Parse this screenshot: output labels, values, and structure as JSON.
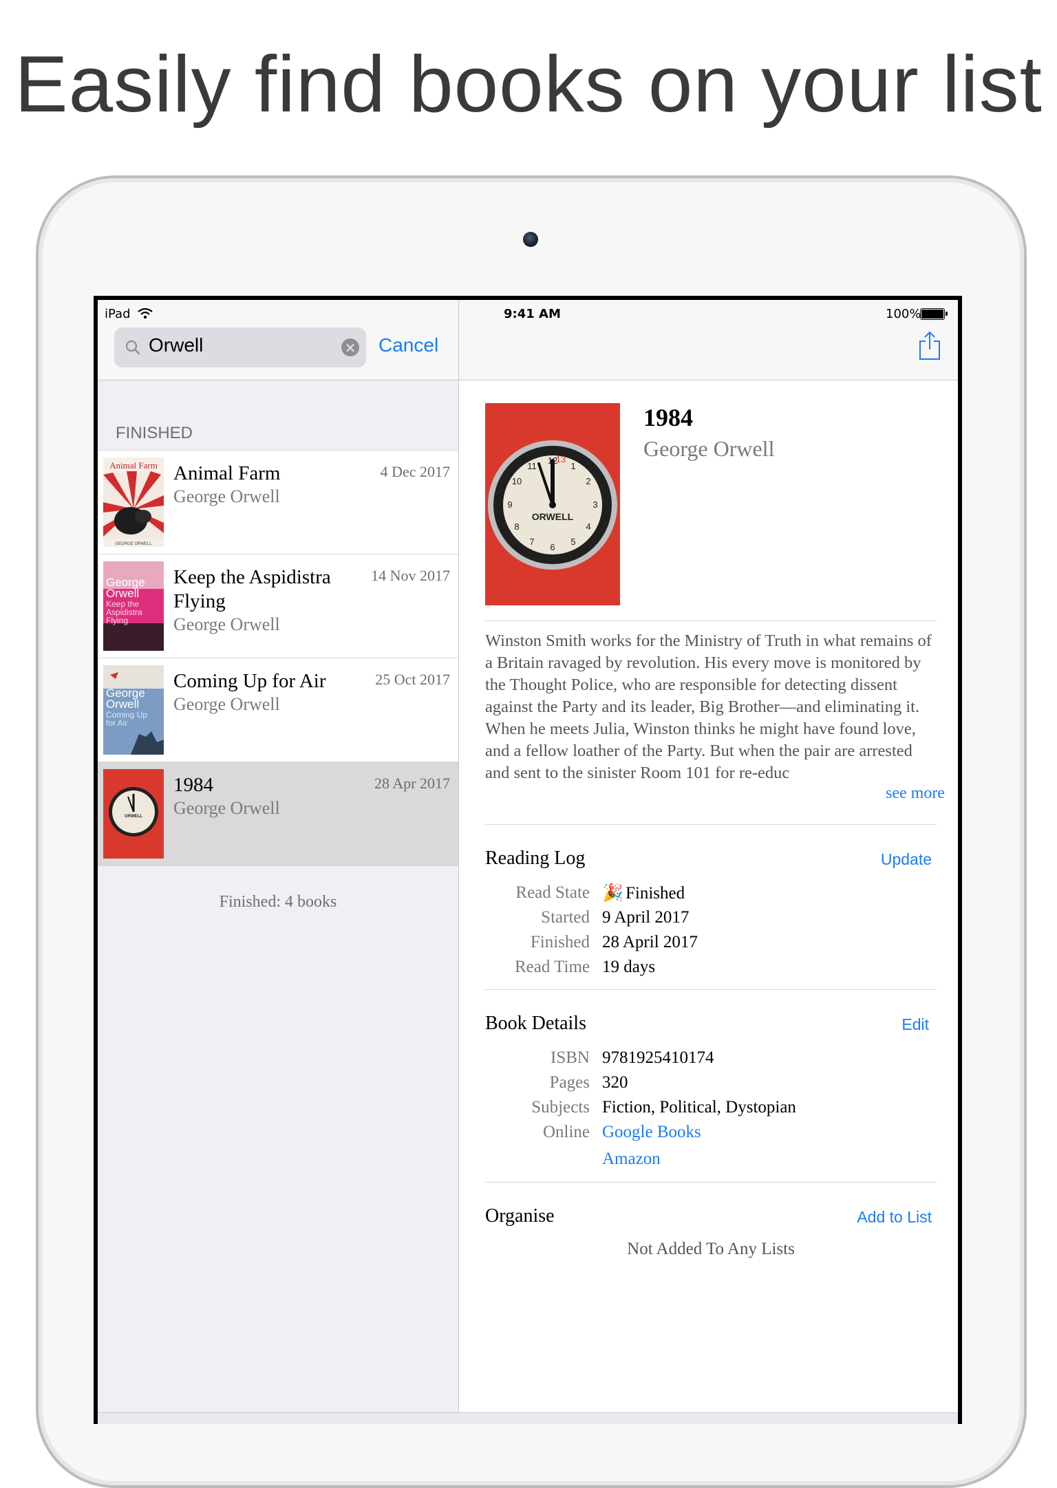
{
  "headline": "Easily find books on your list",
  "status_bar": {
    "carrier": "iPad",
    "time": "9:41 AM",
    "battery": "100%"
  },
  "search": {
    "query": "Orwell",
    "cancel_label": "Cancel"
  },
  "list": {
    "section_header": "FINISHED",
    "books": [
      {
        "title": "Animal Farm",
        "author": "George Orwell",
        "date": "4 Dec 2017"
      },
      {
        "title": "Keep the Aspidistra Flying",
        "author": "George Orwell",
        "date": "14 Nov 2017"
      },
      {
        "title": "Coming Up for Air",
        "author": "George Orwell",
        "date": "25 Oct 2017"
      },
      {
        "title": "1984",
        "author": "George Orwell",
        "date": "28 Apr 2017"
      }
    ],
    "footer": "Finished: 4 books"
  },
  "covers": {
    "animal_farm": {
      "title_text": "Animal Farm",
      "author_text": "GEORGE ORWELL"
    },
    "aspidistra": {
      "lines": [
        "George",
        "Orwell",
        "Keep the",
        "Aspidistra",
        "Flying"
      ]
    },
    "coming_up": {
      "lines": [
        "George",
        "Orwell",
        "Coming Up",
        "for Air"
      ]
    },
    "nineteen": {
      "label": "ORWELL"
    }
  },
  "detail": {
    "title": "1984",
    "author": "George Orwell",
    "description": "Winston Smith works for the Ministry of Truth in what remains of a Britain ravaged by revolution. His every move is monitored by the Thought Police, who are responsible for detecting dissent against the Party and its leader, Big Brother—and eliminating it. When he meets Julia, Winston thinks he might have found love, and a fellow loather of the Party. But when the pair are arrested and sent to the sinister Room 101 for re-educ",
    "see_more": "see more",
    "reading_log": {
      "title": "Reading Log",
      "action": "Update",
      "rows": [
        {
          "label": "Read State",
          "value": "Finished",
          "icon": "party-popper-icon"
        },
        {
          "label": "Started",
          "value": "9 April 2017"
        },
        {
          "label": "Finished",
          "value": "28 April 2017"
        },
        {
          "label": "Read Time",
          "value": "19 days"
        }
      ]
    },
    "book_details": {
      "title": "Book Details",
      "action": "Edit",
      "rows": [
        {
          "label": "ISBN",
          "value": "9781925410174"
        },
        {
          "label": "Pages",
          "value": "320"
        },
        {
          "label": "Subjects",
          "value": "Fiction, Political, Dystopian"
        },
        {
          "label": "Online",
          "value": "Google Books"
        }
      ],
      "extra_link": "Amazon"
    },
    "organise": {
      "title": "Organise",
      "action": "Add to List",
      "empty": "Not Added To Any Lists"
    }
  },
  "colors": {
    "accent": "#1a7cf5",
    "cover_red": "#d9392c",
    "selected_row": "#d9d9d9"
  }
}
